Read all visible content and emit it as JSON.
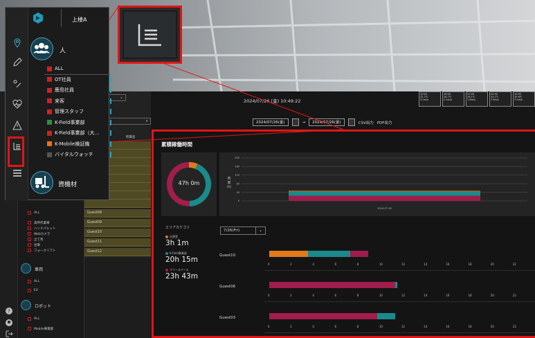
{
  "inset": {
    "site_label": "上楼A",
    "person_section": "人",
    "asset_section": "資機材",
    "items": [
      {
        "label": "ALL",
        "color": "#d42020"
      },
      {
        "label": "OT社員",
        "color": "#d42020"
      },
      {
        "label": "鹿島社員",
        "color": "#d42020"
      },
      {
        "label": "来客",
        "color": "#d42020"
      },
      {
        "label": "管理スタッフ",
        "color": "#d42020"
      },
      {
        "label": "K-Field事業部",
        "color": "#2f8f3a"
      },
      {
        "label": "K-Field事業部（大...",
        "color": "#d42020"
      },
      {
        "label": "K-Mobile検証機",
        "color": "#f07010"
      },
      {
        "label": "バイタルウォッチ",
        "color": "#555555"
      }
    ]
  },
  "topbar": {
    "datetime": "2024/07/26 (金) 10:49:22",
    "weather": [
      {
        "time": "10:00",
        "temp": "32.7℃",
        "wind": "3.0m/s"
      },
      {
        "time": "16:00",
        "temp": "26.7℃",
        "wind": "2.4m/s"
      },
      {
        "time": "22:00",
        "temp": "26.1℃",
        "wind": "1.8m/s"
      },
      {
        "time": "04:00",
        "temp": "24.1℃",
        "wind": "3.6m/s"
      },
      {
        "time": "10:00",
        "temp": "35.8℃",
        "wind": "3.0m/s"
      }
    ]
  },
  "daterange": {
    "from": "2024/07/26(金)",
    "arrow": "→",
    "to": "2024/07/26(金)",
    "csv": "CSV出力",
    "pdf": "PDF出力"
  },
  "left": {
    "section_robot": "ロボット",
    "section_vehicle": "車両",
    "robot_items": [
      "ALL",
      "Mobile事業部"
    ],
    "vehicle_items": [
      "ALL",
      "EV"
    ],
    "tool_items": [
      "ALL",
      "高所作業車",
      "ハンドパレット",
      "Webカメラ",
      "立て馬",
      "台車",
      "フォークリフト"
    ],
    "guest_header": "所属名",
    "guests": [
      "Guest08",
      "Guest09",
      "Guest10",
      "Guest11",
      "Guest12"
    ]
  },
  "panel": {
    "title": "累積稼働時間",
    "total": "47h 0m",
    "ylabel": "時\n間\n(h)",
    "xlabel": "2024-07-26",
    "yticks": [
      "200",
      "160",
      "120",
      "80",
      "40",
      "0"
    ],
    "area_caption": "エリアカテゴリ",
    "legend": [
      {
        "name": "出張室",
        "value": "3h 1m",
        "color": "#e07a1c"
      },
      {
        "name": "K-Field事業部",
        "value": "20h 15m",
        "color": "#1a8a8a"
      },
      {
        "name": "フリースペース",
        "value": "23h 43m",
        "color": "#a01d4c"
      }
    ],
    "day_select": "7/26(Fri)",
    "hour_ticks": [
      "0",
      "2",
      "4",
      "6",
      "8",
      "10",
      "12",
      "14",
      "16",
      "18",
      "20",
      "22",
      "24"
    ],
    "rows": [
      {
        "name": "Guest10",
        "segments": [
          {
            "start": 0,
            "end": 3.5,
            "color": "#e07a1c"
          },
          {
            "start": 3.5,
            "end": 7.3,
            "color": "#1a8a8a"
          },
          {
            "start": 7.3,
            "end": 8.9,
            "color": "#a01d4c"
          }
        ]
      },
      {
        "name": "Guest06",
        "segments": [
          {
            "start": 0,
            "end": 11.3,
            "color": "#a01d4c"
          },
          {
            "start": 11.3,
            "end": 11.5,
            "color": "#1a8a8a"
          }
        ]
      },
      {
        "name": "Guest03",
        "segments": [
          {
            "start": 0,
            "end": 9.7,
            "color": "#a01d4c"
          },
          {
            "start": 9.7,
            "end": 11.3,
            "color": "#1a8a8a"
          }
        ]
      }
    ]
  },
  "chart_data": {
    "type": "bar",
    "categories": [
      "2024-07-26"
    ],
    "series": [
      {
        "name": "フリースペース",
        "values": [
          23.7
        ]
      },
      {
        "name": "K-Field事業部",
        "values": [
          20.25
        ]
      },
      {
        "name": "出張室",
        "values": [
          3.0
        ]
      }
    ],
    "ylim": [
      0,
      200
    ],
    "xlabel": "2024-07-26",
    "ylabel": "時間(h)"
  }
}
